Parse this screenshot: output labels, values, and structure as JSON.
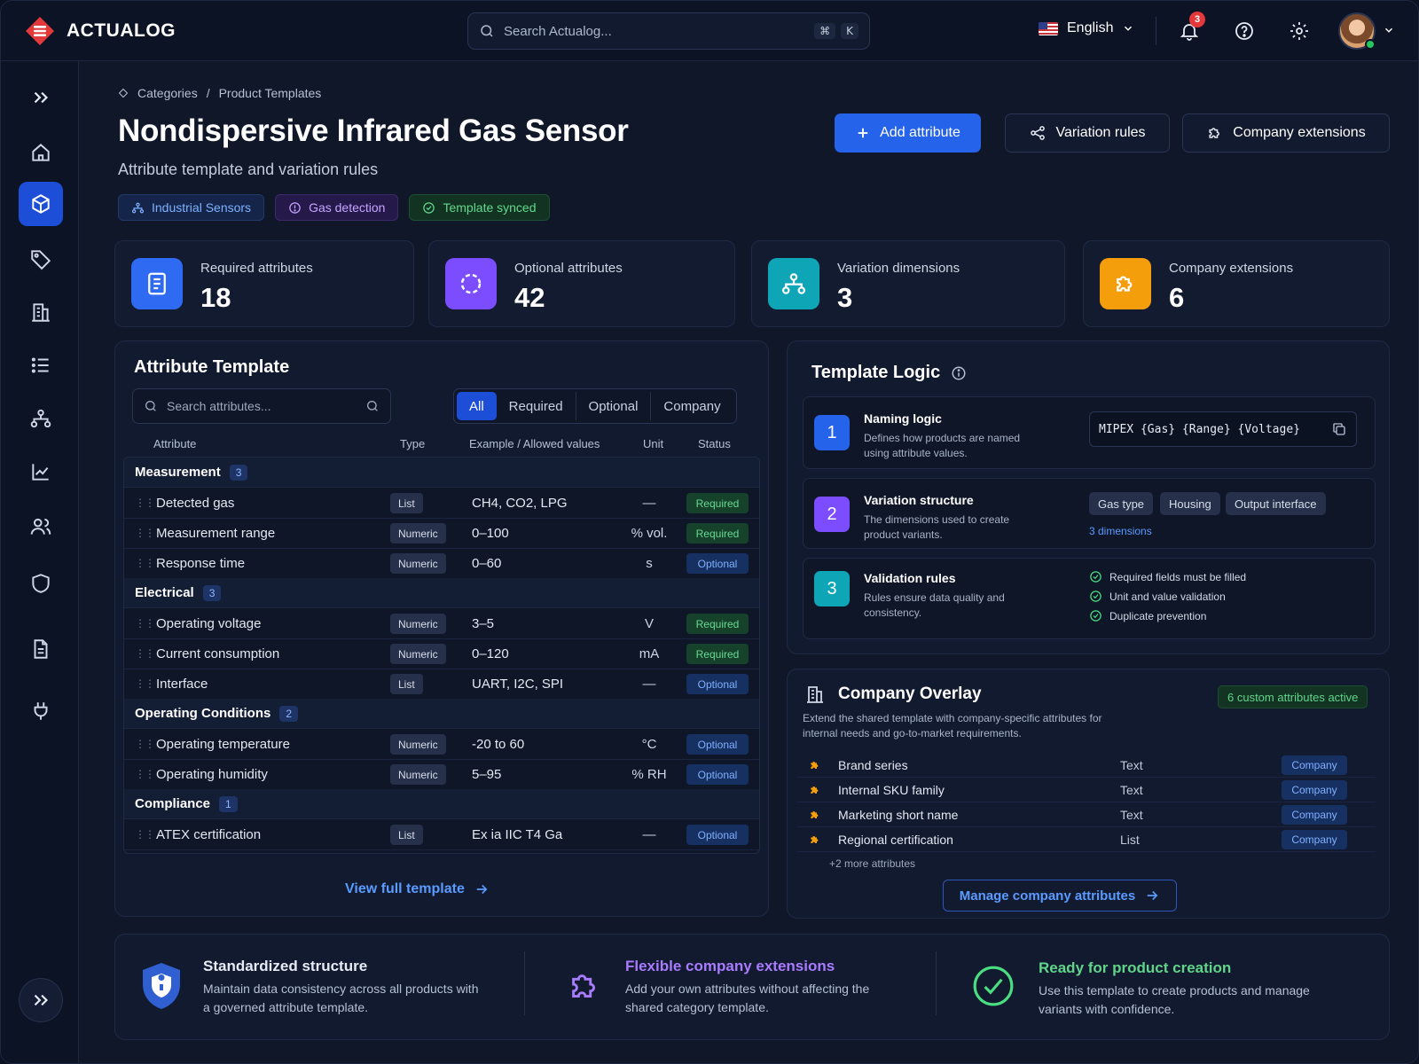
{
  "app": {
    "name": "ACTUALOG"
  },
  "header": {
    "search_placeholder": "Search Actualog...",
    "shortcut_keys": [
      "⌘",
      "K"
    ],
    "language": "English",
    "notification_count": "3"
  },
  "breadcrumb": {
    "items": [
      "Categories",
      "Product Templates"
    ]
  },
  "page": {
    "title": "Nondispersive Infrared Gas Sensor",
    "subtitle": "Attribute template and variation rules",
    "tags": [
      "Industrial Sensors",
      "Gas detection",
      "Template synced"
    ]
  },
  "actions": {
    "add_attribute": "Add attribute",
    "variation_rules": "Variation rules",
    "company_extensions": "Company extensions"
  },
  "stats": [
    {
      "label": "Required attributes",
      "value": "18",
      "color": "#2f6bf2"
    },
    {
      "label": "Optional attributes",
      "value": "42",
      "color": "#7c4dff"
    },
    {
      "label": "Variation dimensions",
      "value": "3",
      "color": "#0ea5b7"
    },
    {
      "label": "Company extensions",
      "value": "6",
      "color": "#f59e0b"
    }
  ],
  "attribute_template": {
    "title": "Attribute Template",
    "search_placeholder": "Search attributes...",
    "filters": [
      "All",
      "Required",
      "Optional",
      "Company"
    ],
    "active_filter": "All",
    "columns": [
      "Attribute",
      "Type",
      "Example / Allowed values",
      "Unit",
      "Status"
    ],
    "groups": [
      {
        "name": "Measurement",
        "count": "3",
        "rows": [
          {
            "name": "Detected gas",
            "type": "List",
            "example": "CH4, CO2, LPG",
            "unit": "—",
            "status": "Required"
          },
          {
            "name": "Measurement range",
            "type": "Numeric",
            "example": "0–100",
            "unit": "% vol.",
            "status": "Required"
          },
          {
            "name": "Response time",
            "type": "Numeric",
            "example": "0–60",
            "unit": "s",
            "status": "Optional"
          }
        ]
      },
      {
        "name": "Electrical",
        "count": "3",
        "rows": [
          {
            "name": "Operating voltage",
            "type": "Numeric",
            "example": "3–5",
            "unit": "V",
            "status": "Required"
          },
          {
            "name": "Current consumption",
            "type": "Numeric",
            "example": "0–120",
            "unit": "mA",
            "status": "Required"
          },
          {
            "name": "Interface",
            "type": "List",
            "example": "UART, I2C, SPI",
            "unit": "—",
            "status": "Optional"
          }
        ]
      },
      {
        "name": "Operating Conditions",
        "count": "2",
        "rows": [
          {
            "name": "Operating temperature",
            "type": "Numeric",
            "example": "-20 to 60",
            "unit": "°C",
            "status": "Optional"
          },
          {
            "name": "Operating humidity",
            "type": "Numeric",
            "example": "5–95",
            "unit": "% RH",
            "status": "Optional"
          }
        ]
      },
      {
        "name": "Compliance",
        "count": "1",
        "rows": [
          {
            "name": "ATEX certification",
            "type": "List",
            "example": "Ex ia IIC T4 Ga",
            "unit": "—",
            "status": "Optional"
          }
        ]
      }
    ],
    "view_full": "View full template"
  },
  "template_logic": {
    "title": "Template Logic",
    "naming": {
      "num": "1",
      "title": "Naming logic",
      "desc": "Defines how products are named using attribute values.",
      "pattern": "MIPEX {Gas} {Range} {Voltage}"
    },
    "variation": {
      "num": "2",
      "title": "Variation structure",
      "desc": "The dimensions used to create product variants.",
      "chips": [
        "Gas type",
        "Housing",
        "Output interface"
      ],
      "link": "3 dimensions"
    },
    "validation": {
      "num": "3",
      "title": "Validation rules",
      "desc": "Rules ensure data quality and consistency.",
      "checks": [
        "Required fields must be filled",
        "Unit and value validation",
        "Duplicate prevention"
      ]
    }
  },
  "company_overlay": {
    "title": "Company Overlay",
    "badge": "6 custom attributes active",
    "desc": "Extend the shared template with company-specific attributes for internal needs and go-to-market requirements.",
    "rows": [
      {
        "name": "Brand series",
        "type": "Text",
        "status": "Company"
      },
      {
        "name": "Internal SKU family",
        "type": "Text",
        "status": "Company"
      },
      {
        "name": "Marketing short name",
        "type": "Text",
        "status": "Company"
      },
      {
        "name": "Regional certification",
        "type": "List",
        "status": "Company"
      }
    ],
    "more": "+2 more attributes",
    "manage": "Manage company attributes"
  },
  "features": [
    {
      "title": "Standardized structure",
      "desc": "Maintain data consistency across all products with a governed attribute template.",
      "color": "#e6ebf5"
    },
    {
      "title": "Flexible company extensions",
      "desc": "Add your own attributes without affecting the shared category template.",
      "color": "#a97bff"
    },
    {
      "title": "Ready for product creation",
      "desc": "Use this template to create products and manage variants with confidence.",
      "color": "#5fd58a"
    }
  ]
}
